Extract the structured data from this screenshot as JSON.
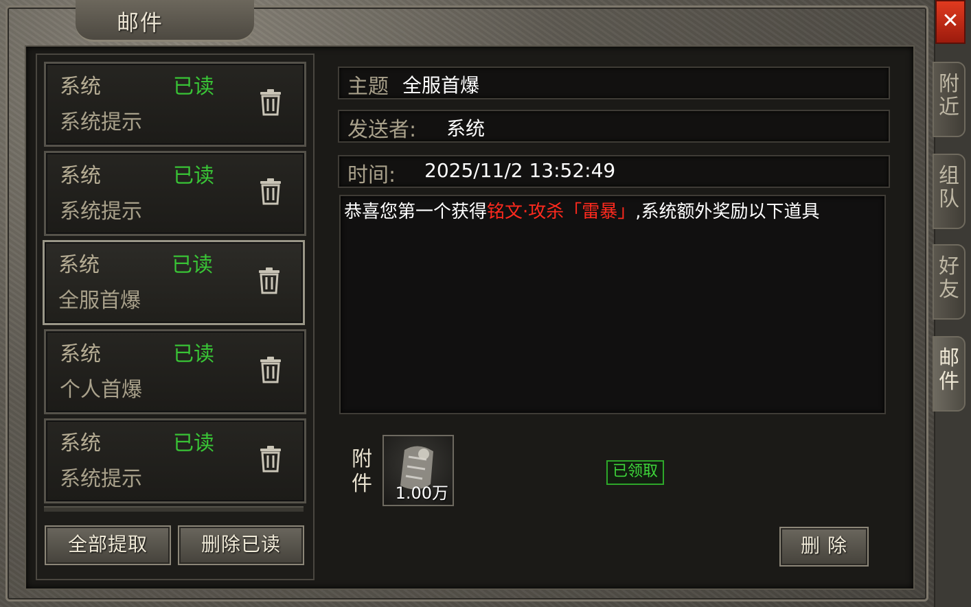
{
  "window": {
    "title": "邮件",
    "close_glyph": "✕"
  },
  "side_tabs": [
    {
      "line1": "附",
      "line2": "近"
    },
    {
      "line1": "组",
      "line2": "队"
    },
    {
      "line1": "好",
      "line2": "友"
    },
    {
      "line1": "邮",
      "line2": "件"
    }
  ],
  "mail_list": [
    {
      "sender": "系统",
      "status": "已读",
      "subject": "系统提示"
    },
    {
      "sender": "系统",
      "status": "已读",
      "subject": "系统提示"
    },
    {
      "sender": "系统",
      "status": "已读",
      "subject": "全服首爆"
    },
    {
      "sender": "系统",
      "status": "已读",
      "subject": "个人首爆"
    },
    {
      "sender": "系统",
      "status": "已读",
      "subject": "系统提示"
    }
  ],
  "list_buttons": {
    "claim_all": "全部提取",
    "delete_read": "删除已读"
  },
  "detail": {
    "subject_label": "主题",
    "subject_value": "全服首爆",
    "sender_label": "发送者:",
    "sender_value": "系统",
    "time_label": "时间:",
    "time_value": "2025/11/2 13:52:49",
    "body_prefix": "恭喜您第一个获得",
    "body_highlight": "铭文·攻杀「雷暴」",
    "body_suffix": ",系统额外奖励以下道具",
    "attach_label_1": "附",
    "attach_label_2": "件",
    "item_qty": "1.00万",
    "claimed_label": "已领取",
    "delete_button": "删 除"
  },
  "colors": {
    "status_green": "#39c436",
    "highlight_red": "#ff2a1e",
    "close_red": "#e03a1f"
  },
  "icons": {
    "trash": "trash-icon",
    "close": "close-icon",
    "attachment_item": "scroll-item-icon"
  }
}
